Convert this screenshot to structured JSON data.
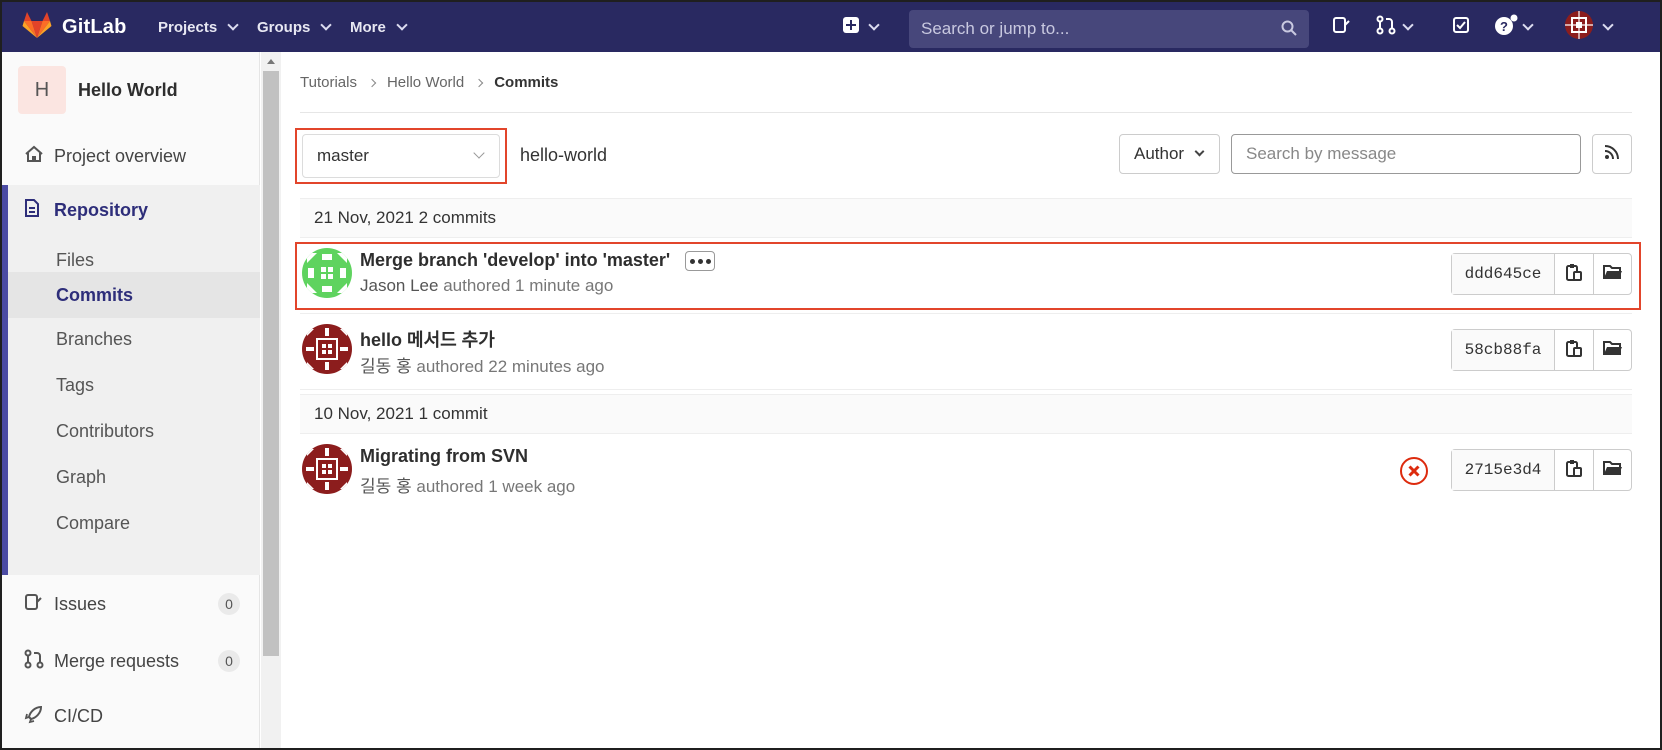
{
  "navbar": {
    "brand": "GitLab",
    "menus": [
      {
        "label": "Projects"
      },
      {
        "label": "Groups"
      },
      {
        "label": "More"
      }
    ],
    "search_placeholder": "Search or jump to...",
    "colors": {
      "bg": "#292961",
      "search_bg": "#47477b"
    }
  },
  "sidebar": {
    "project_initial": "H",
    "project_name": "Hello World",
    "items": [
      {
        "label": "Project overview",
        "icon": "home-icon"
      },
      {
        "label": "Repository",
        "icon": "document-icon"
      },
      {
        "label": "Issues",
        "icon": "issues-icon",
        "count": "0"
      },
      {
        "label": "Merge requests",
        "icon": "merge-request-icon",
        "count": "0"
      },
      {
        "label": "CI/CD",
        "icon": "rocket-icon"
      }
    ],
    "repository_sub": [
      "Files",
      "Commits",
      "Branches",
      "Tags",
      "Contributors",
      "Graph",
      "Compare"
    ],
    "active_sub": "Commits"
  },
  "breadcrumb": [
    "Tutorials",
    "Hello World",
    "Commits"
  ],
  "toolbar": {
    "branch": "master",
    "path": "hello-world",
    "author_label": "Author",
    "search_placeholder": "Search by message"
  },
  "commit_groups": [
    {
      "header": "21 Nov, 2021 2 commits",
      "commits": [
        {
          "title": "Merge branch 'develop' into 'master'",
          "author": "Jason Lee",
          "authored": "authored",
          "time": "1 minute ago",
          "sha": "ddd645ce",
          "has_more": true
        },
        {
          "title": "hello 메서드 추가",
          "author": "길동 홍",
          "authored": "authored",
          "time": "22 minutes ago",
          "sha": "58cb88fa"
        }
      ]
    },
    {
      "header": "10 Nov, 2021 1 commit",
      "commits": [
        {
          "title": "Migrating from SVN",
          "author": "길동 홍",
          "authored": "authored",
          "time": "1 week ago",
          "sha": "2715e3d4",
          "pipeline_status": "failed"
        }
      ]
    }
  ],
  "accent_colors": {
    "highlight": "#e2452b",
    "active_nav": "#4b4ba3",
    "failed": "#dd2b0e"
  }
}
